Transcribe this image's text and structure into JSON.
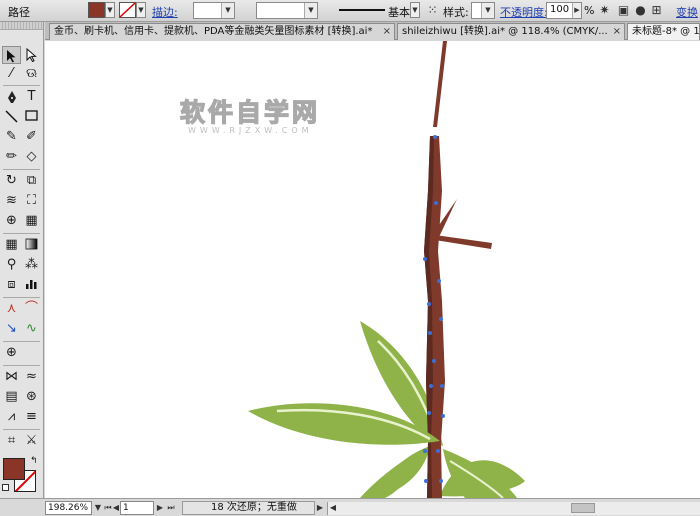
{
  "control_bar": {
    "mode_label": "路径",
    "stroke_link": "描边:",
    "stroke_weight_value": "",
    "brush_style_label": "基本",
    "style_label": "样式:",
    "opacity_link": "不透明度:",
    "opacity_value": "100",
    "opacity_unit": "%",
    "transform_label": "变换"
  },
  "tabs": [
    {
      "label": "金币、刷卡机、信用卡、提款机、PDA等金融类矢量图标素材  [转换].ai*",
      "active": false
    },
    {
      "label": "shileizhiwu  [转换].ai* @ 118.4% (CMYK/...",
      "active": false
    },
    {
      "label": "未标题-8* @ 1...",
      "active": true
    }
  ],
  "tools": {
    "stroke_style_icon": "none-slash",
    "fill_color": "#8b3428",
    "stroke_color": "none"
  },
  "canvas": {
    "watermark_main": "软件自学网",
    "watermark_sub": "WWW.RJZXW.COM",
    "colors": {
      "stem": "#7f3a2c",
      "stem_dark": "#5c2a20",
      "leaf": "#8fb348",
      "leaf_highlight": "#e9f2cf",
      "anchor": "#3c6fd6"
    }
  },
  "status_bar": {
    "zoom": "198.26%",
    "artboard": "1",
    "status_text": "18 次还原；无重做"
  }
}
